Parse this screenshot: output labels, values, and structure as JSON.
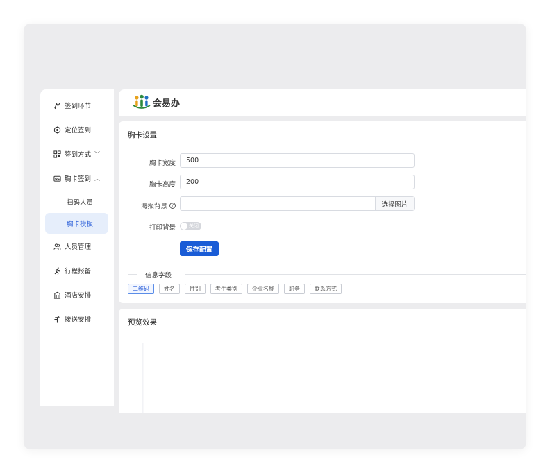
{
  "sidebar": {
    "items": [
      {
        "label": "签到环节",
        "icon": "checkin-flow-icon"
      },
      {
        "label": "定位签到",
        "icon": "target-icon"
      },
      {
        "label": "签到方式",
        "icon": "qr-grid-icon",
        "chevron": "﹀"
      },
      {
        "label": "胸卡签到",
        "icon": "badge-card-icon",
        "chevron": "︿"
      },
      {
        "label": "人员管理",
        "icon": "user-group-icon"
      },
      {
        "label": "行程报备",
        "icon": "running-icon"
      },
      {
        "label": "酒店安排",
        "icon": "building-icon"
      },
      {
        "label": "接送安排",
        "icon": "pickup-icon"
      }
    ],
    "sub_items": [
      {
        "label": "扫码人员",
        "active": false
      },
      {
        "label": "胸卡模板",
        "active": true
      }
    ]
  },
  "header": {
    "logo_text": "会易办"
  },
  "badge_settings": {
    "title": "胸卡设置",
    "width_label": "胸卡宽度",
    "width_value": "500",
    "height_label": "胸卡高度",
    "height_value": "200",
    "poster_label": "海报背景",
    "poster_value": "",
    "poster_button": "选择图片",
    "print_bg_label": "打印背景",
    "print_bg_toggle_text": "关闭",
    "save_button": "保存配置",
    "info_section_label": "信息字段",
    "fields": [
      {
        "label": "二维码",
        "active": true
      },
      {
        "label": "姓名",
        "active": false
      },
      {
        "label": "性别",
        "active": false
      },
      {
        "label": "考生类别",
        "active": false
      },
      {
        "label": "企业名称",
        "active": false
      },
      {
        "label": "职务",
        "active": false
      },
      {
        "label": "联系方式",
        "active": false
      }
    ]
  },
  "preview": {
    "title": "预览效果"
  },
  "colors": {
    "primary": "#1a5cd6",
    "active_bg": "#e6eefb",
    "frame_bg": "#ececee"
  }
}
